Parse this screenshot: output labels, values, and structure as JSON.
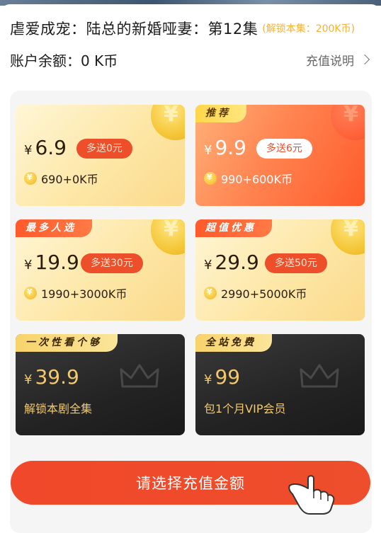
{
  "header": {
    "episode_title": "虐爱成宠：陆总的新婚哑妻：第12集",
    "unlock_hint": "(解锁本集：200K币)",
    "balance_text": "账户余额：0 K币",
    "recharge_help_label": "充值说明"
  },
  "packages": [
    {
      "tag": "",
      "price": "6.9",
      "bonus": "多送0元",
      "coins": "690+0K币",
      "style": "gold"
    },
    {
      "tag": "推荐",
      "price": "9.9",
      "bonus": "多送6元",
      "coins": "990+600K币",
      "style": "orange"
    },
    {
      "tag": "最多人选",
      "price": "19.9",
      "bonus": "多送30元",
      "coins": "1990+3000K币",
      "style": "gold"
    },
    {
      "tag": "超值优惠",
      "price": "29.9",
      "bonus": "多送50元",
      "coins": "2990+5000K币",
      "style": "gold"
    },
    {
      "tag": "一次性看个够",
      "price": "39.9",
      "subtitle": "解锁本剧全集",
      "style": "dark"
    },
    {
      "tag": "全站免费",
      "price": "99",
      "subtitle": "包1个月VIP会员",
      "style": "dark"
    }
  ],
  "currency_symbol": "¥",
  "cta_label": "请选择充值金额",
  "icons": {
    "chevron": "chevron-right-icon",
    "coin": "coin-icon",
    "crown": "crown-icon",
    "hand": "pointing-hand-icon"
  },
  "colors": {
    "accent": "#ee4f2b",
    "gold_text": "#f2c96c",
    "unlock_hint": "#f5b23a"
  }
}
